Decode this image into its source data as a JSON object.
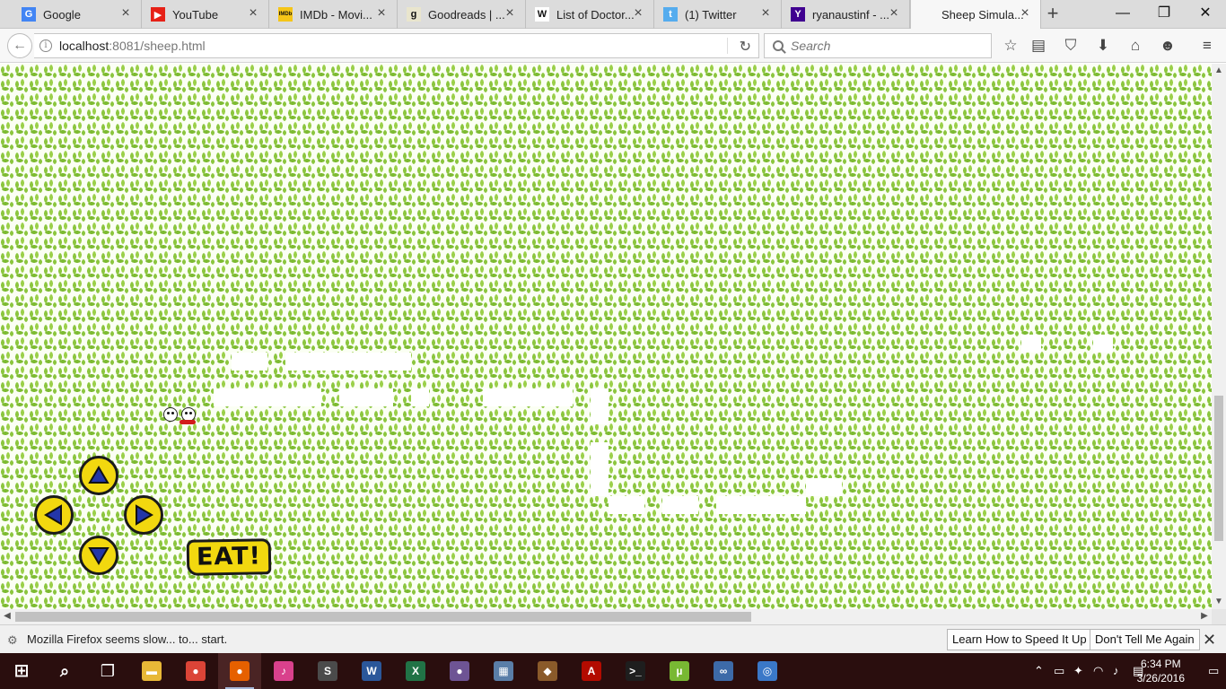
{
  "tabs": [
    {
      "title": "Google",
      "icon": "google-icon",
      "color": "#4285f4",
      "glyph": "G"
    },
    {
      "title": "YouTube",
      "icon": "youtube-icon",
      "color": "#e62117",
      "glyph": "▶"
    },
    {
      "title": "IMDb - Movi...",
      "icon": "imdb-icon",
      "color": "#f5c518",
      "glyph": "IMDb"
    },
    {
      "title": "Goodreads | ...",
      "icon": "goodreads-icon",
      "color": "#e9e5cd",
      "glyph": "g"
    },
    {
      "title": "List of Doctor...",
      "icon": "wikipedia-icon",
      "color": "#ffffff",
      "glyph": "W"
    },
    {
      "title": "(1) Twitter",
      "icon": "twitter-icon",
      "color": "#55acee",
      "glyph": "t"
    },
    {
      "title": "ryanaustinf - ...",
      "icon": "yahoo-icon",
      "color": "#400090",
      "glyph": "Y"
    },
    {
      "title": "Sheep Simula...",
      "icon": "page-icon",
      "color": "#f7f7f7",
      "glyph": ""
    }
  ],
  "window_controls": {
    "minimize": "—",
    "maximize": "❐",
    "close": "✕"
  },
  "navbar": {
    "url_host": "localhost",
    "url_rest": ":8081/sheep.html",
    "search_placeholder": "Search"
  },
  "game": {
    "eat_label": "EAT!",
    "controls": [
      "up",
      "left",
      "right",
      "down"
    ],
    "grass_color": "#8cc63f",
    "button_color": "#f2d80f"
  },
  "notification": {
    "text": "Mozilla Firefox seems slow... to... start.",
    "learn_button": "Learn How to Speed It Up",
    "dismiss_button": "Don't Tell Me Again"
  },
  "taskbar": {
    "apps": [
      {
        "name": "file-explorer",
        "glyph": "▬",
        "color": "#e8b837"
      },
      {
        "name": "chrome",
        "glyph": "●",
        "color": "#db4437"
      },
      {
        "name": "firefox",
        "glyph": "●",
        "color": "#e66000"
      },
      {
        "name": "itunes",
        "glyph": "♪",
        "color": "#d9418c"
      },
      {
        "name": "sublime-text",
        "glyph": "S",
        "color": "#4b4b4b"
      },
      {
        "name": "word",
        "glyph": "W",
        "color": "#2b579a"
      },
      {
        "name": "excel",
        "glyph": "X",
        "color": "#217346"
      },
      {
        "name": "github",
        "glyph": "●",
        "color": "#6e5494"
      },
      {
        "name": "photos",
        "glyph": "▦",
        "color": "#5a7ea8"
      },
      {
        "name": "game-app",
        "glyph": "◆",
        "color": "#8a5a2a"
      },
      {
        "name": "acrobat",
        "glyph": "A",
        "color": "#b30b00"
      },
      {
        "name": "terminal",
        "glyph": ">_",
        "color": "#1e1e1e"
      },
      {
        "name": "utorrent",
        "glyph": "µ",
        "color": "#78b833"
      },
      {
        "name": "visual-studio",
        "glyph": "∞",
        "color": "#3d6aa8"
      },
      {
        "name": "browser-app",
        "glyph": "◎",
        "color": "#3a78c8"
      }
    ],
    "time": "6:34 PM",
    "date": "3/26/2016"
  }
}
